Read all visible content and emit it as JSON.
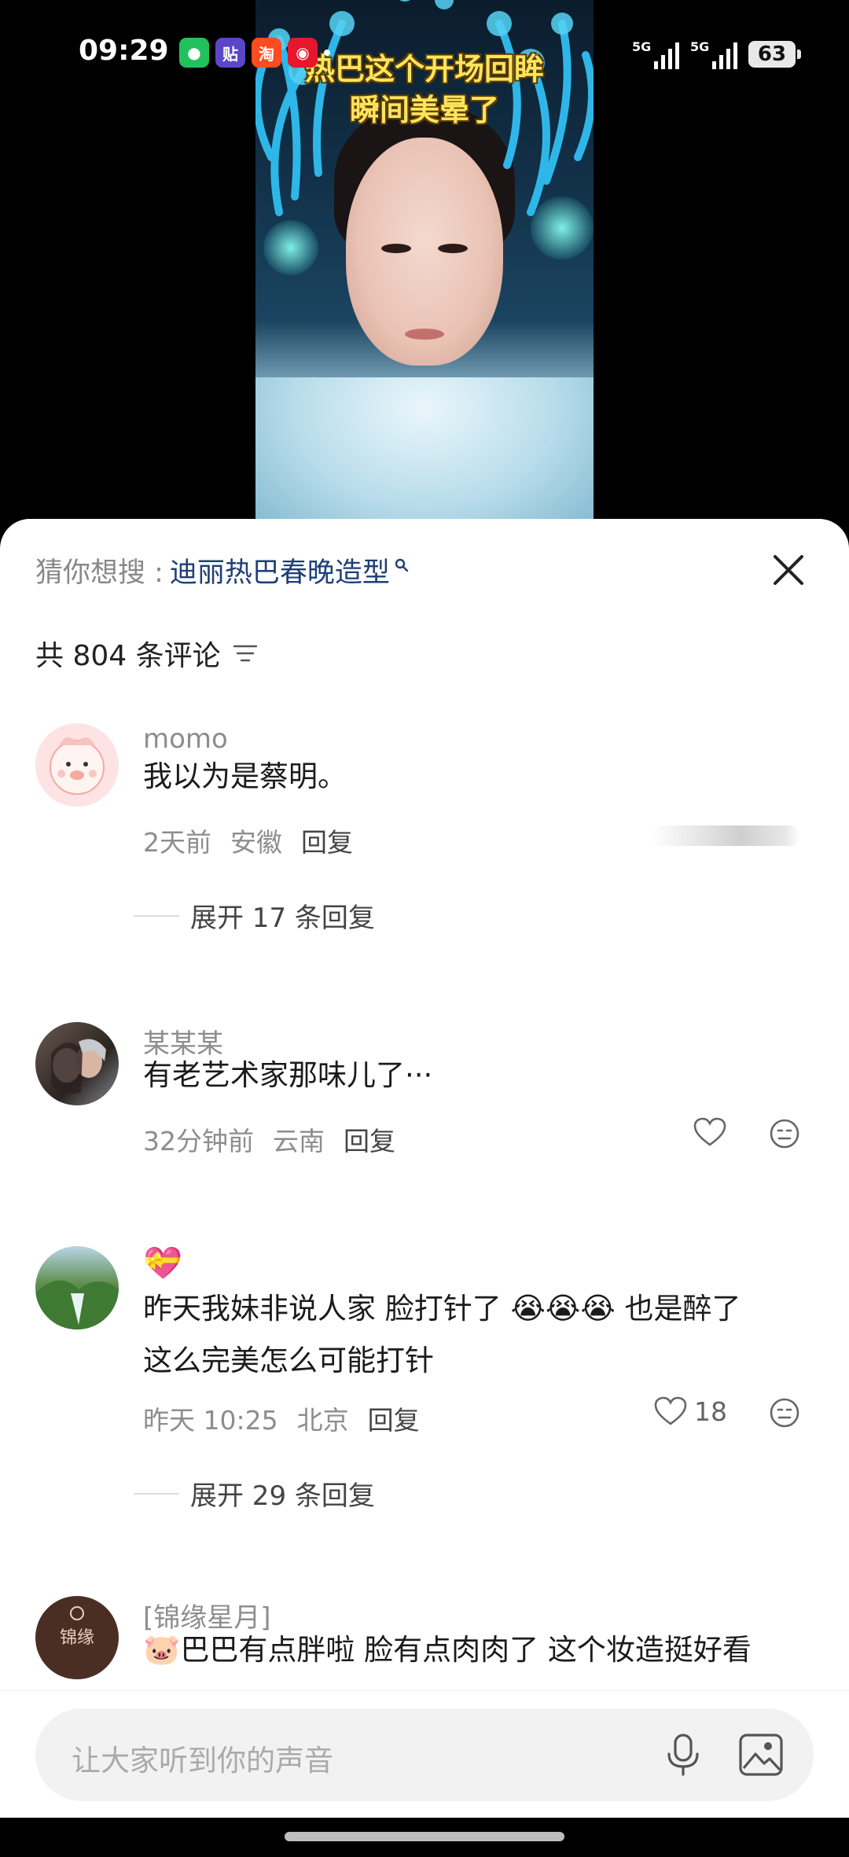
{
  "status_bar": {
    "time": "09:29",
    "network_1": "5G",
    "network_2": "5G",
    "battery": "63"
  },
  "status_apps": [
    {
      "name": "wechat",
      "glyph": "●",
      "color": "#22c15e"
    },
    {
      "name": "tiezi",
      "glyph": "贴",
      "color": "#5b46c9"
    },
    {
      "name": "taobao",
      "glyph": "淘",
      "color": "#ff4b1f"
    },
    {
      "name": "weibo",
      "glyph": "◉",
      "color": "#e6162d"
    }
  ],
  "video": {
    "caption_line1": "热巴这个开场回眸",
    "caption_line2": "瞬间美晕了"
  },
  "sheet": {
    "suggest_label": "猜你想搜 :",
    "suggest_term": "迪丽热巴春晚造型",
    "comment_count": "共 804 条评论"
  },
  "comments": [
    {
      "user": "momo",
      "text": "我以为是蔡明。",
      "time": "2天前",
      "location": "安徽",
      "reply": "回复",
      "expand": "展开 17 条回复"
    },
    {
      "user": "某某某",
      "text": "有老艺术家那味儿了···",
      "time": "32分钟前",
      "location": "云南",
      "reply": "回复"
    },
    {
      "user_emoji": "💝",
      "text_line1": "昨天我妹非说人家 脸打针了",
      "text_line1_tail": "也是醉了",
      "text_line2": "这么完美怎么可能打针",
      "time": "昨天 10:25",
      "location": "北京",
      "reply": "回复",
      "likes": "18",
      "expand": "展开 29 条回复"
    },
    {
      "user": "[锦缘星月]",
      "text": "巴巴有点胖啦 脸有点肉肉了 这个妆造挺好看",
      "avatar_text": "锦缘"
    }
  ],
  "input": {
    "placeholder": "让大家听到你的声音"
  },
  "colors": {
    "link": "#1e3f78",
    "muted": "#8d8d8d",
    "caption": "#ffe45c"
  }
}
